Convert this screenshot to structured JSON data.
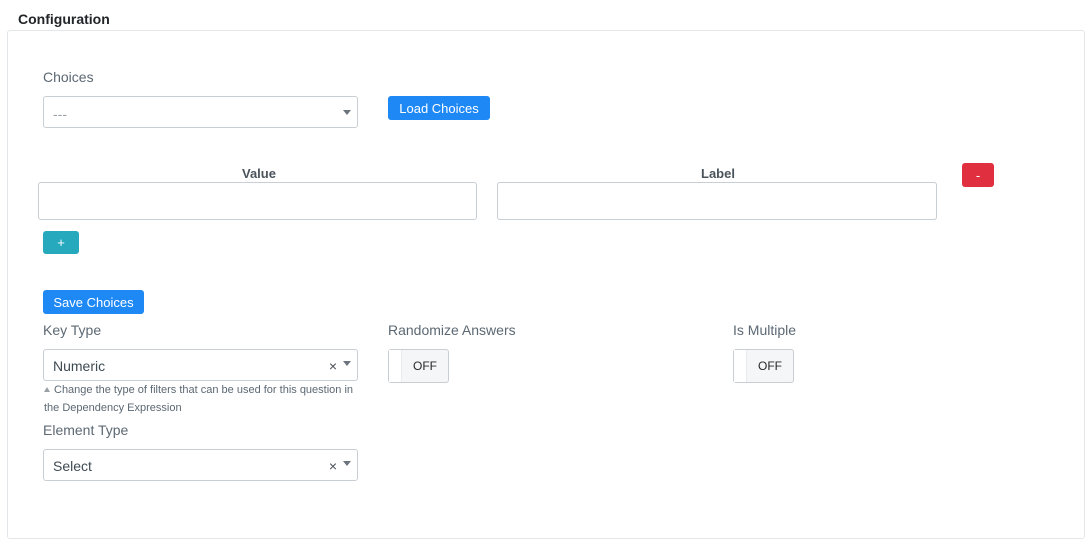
{
  "header": {
    "title": "Configuration"
  },
  "choices": {
    "label": "Choices",
    "select_value": "---",
    "load_button": "Load Choices"
  },
  "table": {
    "value_header": "Value",
    "label_header": "Label",
    "remove_button": "-",
    "add_button": "+",
    "rows": [
      {
        "value": "",
        "label": ""
      }
    ]
  },
  "save_button": "Save Choices",
  "key_type": {
    "label": "Key Type",
    "value": "Numeric",
    "clear": "×",
    "help": "Change the type of filters that can be used for this question in the Dependency Expression"
  },
  "randomize": {
    "label": "Randomize Answers",
    "state": "OFF"
  },
  "is_multiple": {
    "label": "Is Multiple",
    "state": "OFF"
  },
  "element_type": {
    "label": "Element Type",
    "value": "Select",
    "clear": "×"
  }
}
